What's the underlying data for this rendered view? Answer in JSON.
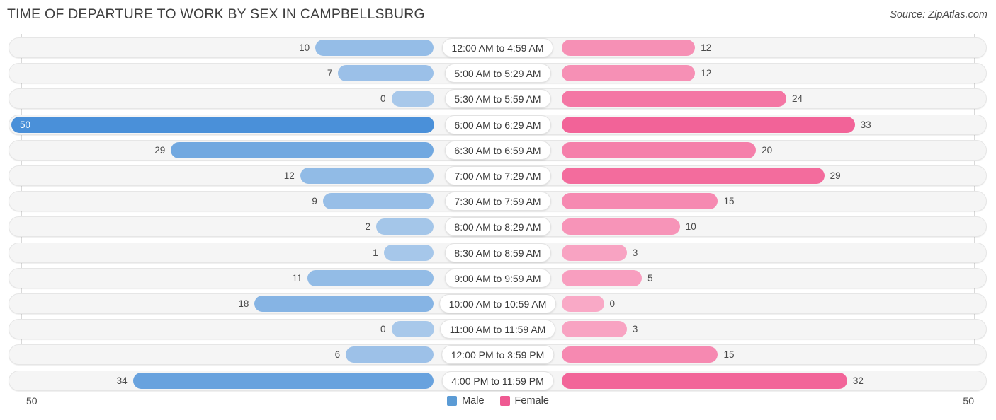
{
  "header": {
    "title": "TIME OF DEPARTURE TO WORK BY SEX IN CAMPBELLSBURG",
    "source": "Source: ZipAtlas.com"
  },
  "axis": {
    "left_end": "50",
    "right_end": "50"
  },
  "legend": {
    "items": [
      {
        "label": "Male",
        "color": "#5b9bd5"
      },
      {
        "label": "Female",
        "color": "#ef5a92"
      }
    ]
  },
  "colors": {
    "male_light": "#a8c8ea",
    "male_dark": "#4a90d9",
    "female_light": "#f9a9c6",
    "female_dark": "#ee3f80",
    "track": "#f5f5f5",
    "grid": "#d9d9d9"
  },
  "chart_data": {
    "type": "bar",
    "subtype": "diverging-bidirectional",
    "title": "TIME OF DEPARTURE TO WORK BY SEX IN CAMPBELLSBURG",
    "xlabel": "",
    "ylabel": "",
    "xlim": [
      50,
      50
    ],
    "axis_left_max": 50,
    "axis_right_max": 50,
    "grid": true,
    "legend_position": "bottom-center",
    "categories": [
      "12:00 AM to 4:59 AM",
      "5:00 AM to 5:29 AM",
      "5:30 AM to 5:59 AM",
      "6:00 AM to 6:29 AM",
      "6:30 AM to 6:59 AM",
      "7:00 AM to 7:29 AM",
      "7:30 AM to 7:59 AM",
      "8:00 AM to 8:29 AM",
      "8:30 AM to 8:59 AM",
      "9:00 AM to 9:59 AM",
      "10:00 AM to 10:59 AM",
      "11:00 AM to 11:59 AM",
      "12:00 PM to 3:59 PM",
      "4:00 PM to 11:59 PM"
    ],
    "series": [
      {
        "name": "Male",
        "side": "left",
        "values": [
          10,
          7,
          0,
          50,
          29,
          12,
          9,
          2,
          1,
          11,
          18,
          0,
          6,
          34
        ]
      },
      {
        "name": "Female",
        "side": "right",
        "values": [
          12,
          12,
          24,
          33,
          20,
          29,
          15,
          10,
          3,
          5,
          0,
          3,
          15,
          32
        ]
      }
    ]
  }
}
